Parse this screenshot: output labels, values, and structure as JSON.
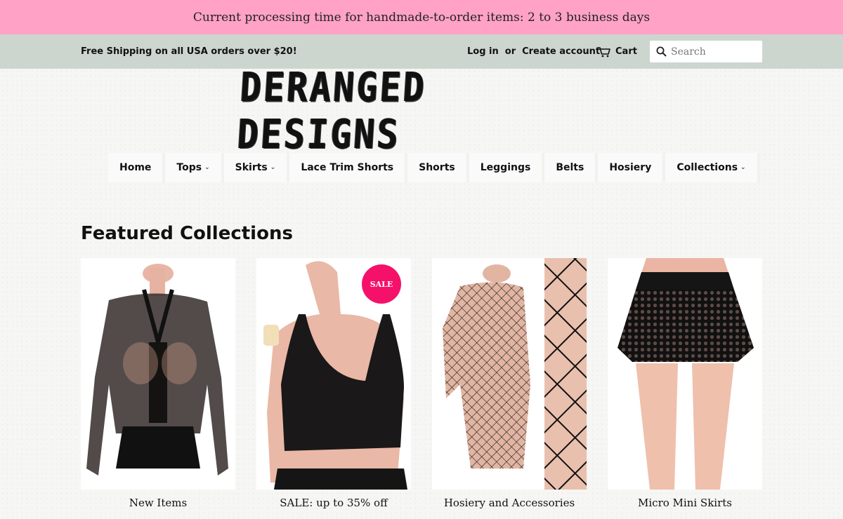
{
  "announcement": "Current processing time for handmade-to-order items: 2 to 3 business days",
  "topbar": {
    "shipping": "Free Shipping on all USA orders over $20!",
    "login": "Log in",
    "or": "or",
    "create_account": "Create account",
    "cart": "Cart",
    "search_placeholder": "Search"
  },
  "logo": "DERANGED DESIGNS",
  "nav": {
    "home": "Home",
    "tops": "Tops",
    "skirts": "Skirts",
    "lace_trim_shorts": "Lace Trim Shorts",
    "shorts": "Shorts",
    "leggings": "Leggings",
    "belts": "Belts",
    "hosiery": "Hosiery",
    "collections": "Collections"
  },
  "featured": {
    "title": "Featured Collections",
    "sale_badge": "SALE",
    "collections": [
      {
        "title": "New Items"
      },
      {
        "title": "SALE: up to 35% off"
      },
      {
        "title": "Hosiery and Accessories"
      },
      {
        "title": "Micro Mini Skirts"
      }
    ]
  },
  "colors": {
    "announcement_bg": "#ffa2c5",
    "topbar_bg": "#cdd6ce",
    "sale_badge": "#f5116a"
  }
}
